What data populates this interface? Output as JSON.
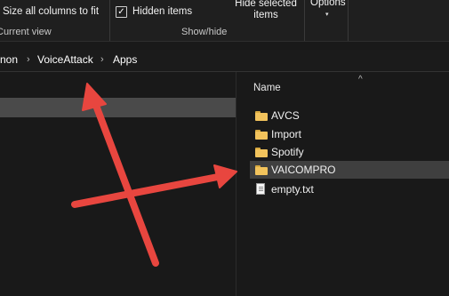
{
  "ribbon": {
    "size_all_columns": "Size all columns to fit",
    "current_view_label": "Current view",
    "hidden_items_label": "Hidden items",
    "hidden_items_checked": "✓",
    "hide_selected_line1": "Hide selected",
    "hide_selected_line2": "items",
    "show_hide_label": "Show/hide",
    "options_label": "Options",
    "options_caret": "▾"
  },
  "address": {
    "crumbs": [
      "non",
      "VoiceAttack",
      "Apps"
    ],
    "separator": "›"
  },
  "files": {
    "column_name": "Name",
    "sort_caret": "^",
    "items": [
      {
        "name": "AVCS",
        "type": "folder"
      },
      {
        "name": "Import",
        "type": "folder"
      },
      {
        "name": "Spotify",
        "type": "folder"
      },
      {
        "name": "VAICOMPRO",
        "type": "folder"
      },
      {
        "name": "empty.txt",
        "type": "text-file"
      }
    ]
  },
  "colors": {
    "arrow": "#e8463f",
    "folder": "#f2c35c",
    "selection": "#3f3f3f",
    "background": "#191919"
  }
}
